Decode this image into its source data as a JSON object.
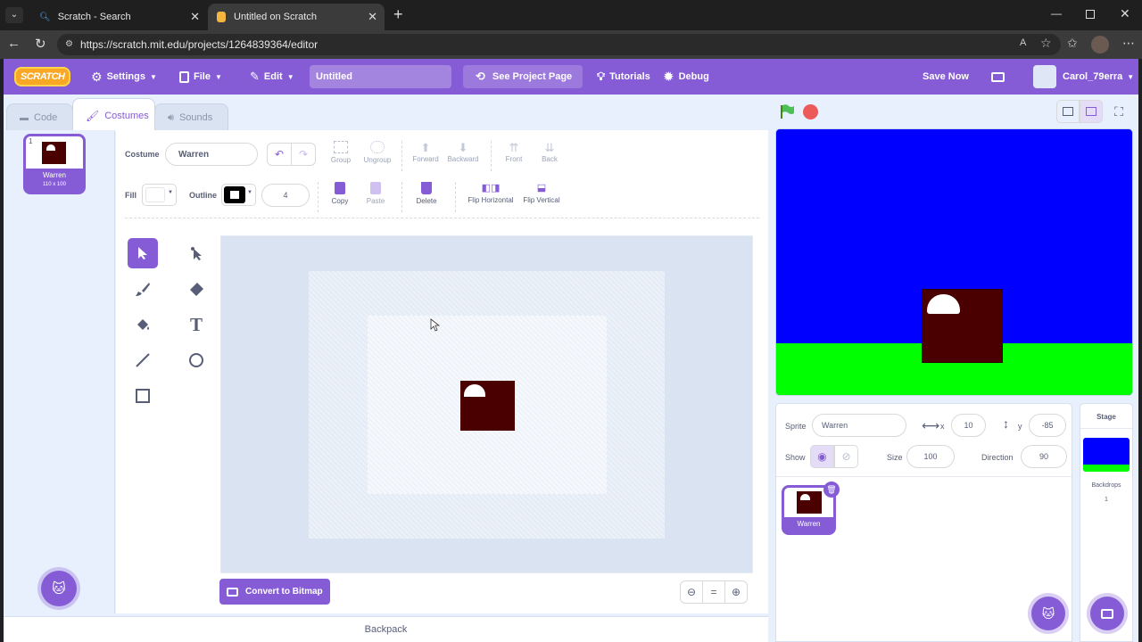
{
  "browser": {
    "tabs": [
      {
        "title": "Scratch - Search",
        "active": false
      },
      {
        "title": "Untitled on Scratch",
        "active": true
      }
    ],
    "url": "https://scratch.mit.edu/projects/1264839364/editor"
  },
  "menubar": {
    "logo": "SCRATCH",
    "settings": "Settings",
    "file": "File",
    "edit": "Edit",
    "project_title": "Untitled",
    "see_project_page": "See Project Page",
    "tutorials": "Tutorials",
    "debug": "Debug",
    "save_now": "Save Now",
    "username": "Carol_79erra"
  },
  "editor_tabs": {
    "code": "Code",
    "costumes": "Costumes",
    "sounds": "Sounds"
  },
  "costume_list": [
    {
      "index": "1",
      "name": "Warren",
      "size": "110 x 100"
    }
  ],
  "paint": {
    "costume_label": "Costume",
    "costume_name": "Warren",
    "fill_label": "Fill",
    "outline_label": "Outline",
    "outline_width": "4",
    "buttons": {
      "group": "Group",
      "ungroup": "Ungroup",
      "forward": "Forward",
      "backward": "Backward",
      "front": "Front",
      "back": "Back",
      "copy": "Copy",
      "paste": "Paste",
      "delete": "Delete",
      "flip_horizontal": "Flip Horizontal",
      "flip_vertical": "Flip Vertical"
    },
    "convert": "Convert to Bitmap",
    "zoom_reset": "="
  },
  "backpack": "Backpack",
  "sprite_info": {
    "sprite_label": "Sprite",
    "sprite_name": "Warren",
    "x_label": "x",
    "x": "10",
    "y_label": "y",
    "y": "-85",
    "show_label": "Show",
    "size_label": "Size",
    "size": "100",
    "direction_label": "Direction",
    "direction": "90"
  },
  "sprites": [
    {
      "name": "Warren"
    }
  ],
  "stage_panel": {
    "title": "Stage",
    "backdrops_label": "Backdrops",
    "backdrops_count": "1"
  },
  "colors": {
    "accent": "#855cd6",
    "sky": "#0000ff",
    "ground": "#00ff00",
    "sprite_body": "#4a0000"
  }
}
